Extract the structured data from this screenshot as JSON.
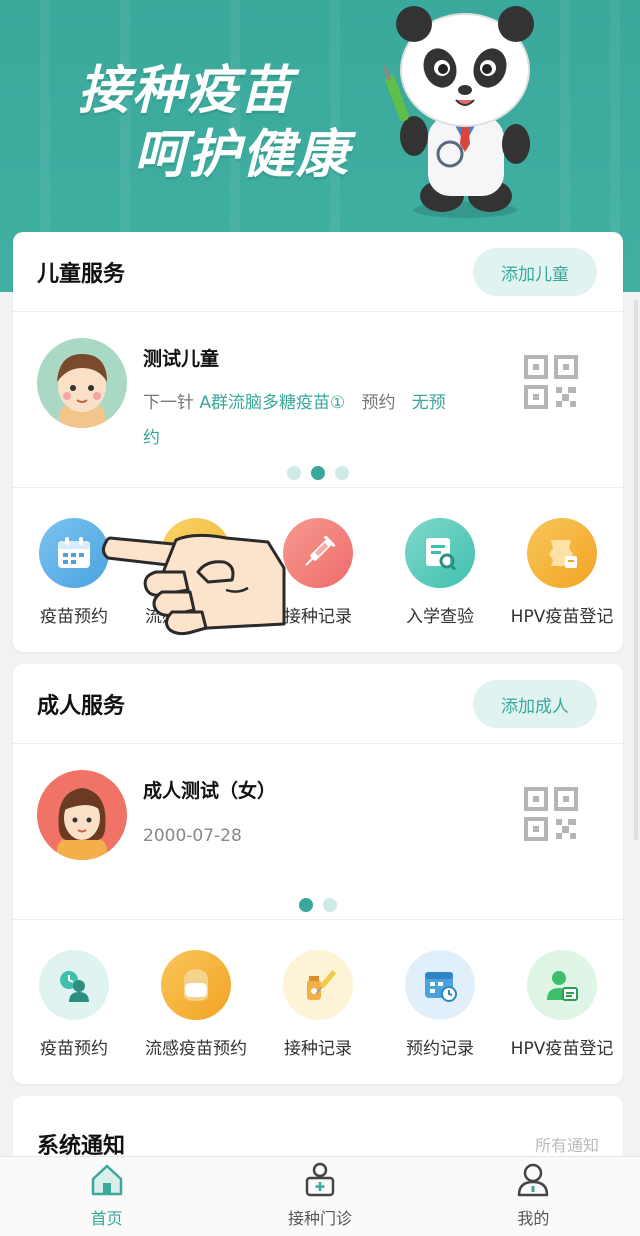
{
  "banner": {
    "line1": "接种疫苗",
    "line2": "呵护健康"
  },
  "child_service": {
    "title": "儿童服务",
    "add_button": "添加儿童",
    "child": {
      "name": "测试儿童",
      "next_prefix": "下一针",
      "next_vaccine": "A群流脑多糖疫苗①",
      "appoint_label": "预约",
      "appoint_status_1": "无预",
      "appoint_status_2": "约"
    },
    "carousel_active_index": 1,
    "carousel_count": 3,
    "icons": [
      {
        "label": "疫苗预约",
        "icon": "calendar-icon",
        "color": "#4aa3df"
      },
      {
        "label": "流感疫苗预约",
        "icon": "flu-icon",
        "color": "#f2b630"
      },
      {
        "label": "接种记录",
        "icon": "syringe-icon",
        "color": "#ef6b6b"
      },
      {
        "label": "入学查验",
        "icon": "document-search-icon",
        "color": "#3fbfae"
      },
      {
        "label": "HPV疫苗登记",
        "icon": "hpv-icon",
        "color": "#f3a323"
      }
    ]
  },
  "adult_service": {
    "title": "成人服务",
    "add_button": "添加成人",
    "adult": {
      "name": "成人测试（女）",
      "birth": "2000-07-28"
    },
    "carousel_active_index": 0,
    "carousel_count": 2,
    "icons": [
      {
        "label": "疫苗预约",
        "icon": "person-clock-icon",
        "color": "#3fbfae"
      },
      {
        "label": "流感疫苗预约",
        "icon": "mask-face-icon",
        "color": "#f2b630"
      },
      {
        "label": "接种记录",
        "icon": "vial-icon",
        "color": "#f2c94c"
      },
      {
        "label": "预约记录",
        "icon": "calendar-clock-icon",
        "color": "#4aa3df"
      },
      {
        "label": "HPV疫苗登记",
        "icon": "person-card-icon",
        "color": "#3fbf6e"
      }
    ]
  },
  "notice": {
    "title": "系统通知",
    "more": "所有通知"
  },
  "tabbar": {
    "items": [
      {
        "label": "首页",
        "icon": "home-icon",
        "active": true
      },
      {
        "label": "接种门诊",
        "icon": "clinic-icon",
        "active": false
      },
      {
        "label": "我的",
        "icon": "user-icon",
        "active": false
      }
    ]
  },
  "colors": {
    "primary": "#3aa89b",
    "pill_bg": "#e1f3f1",
    "page_bg": "#f1f2f4"
  }
}
